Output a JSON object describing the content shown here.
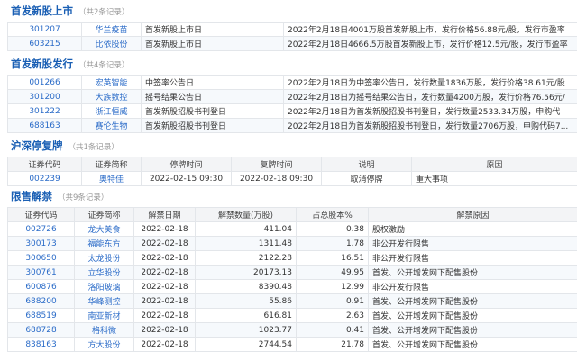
{
  "ipo_listing": {
    "title": "首发新股上市",
    "count": "（共2条记录）",
    "rows": [
      {
        "code": "301207",
        "name": "华兰疫苗",
        "event": "首发新股上市日",
        "desc": "2022年2月18日4001万股首发新股上市，发行价格56.88元/股，发行市盈率"
      },
      {
        "code": "603215",
        "name": "比依股份",
        "event": "首发新股上市日",
        "desc": "2022年2月18日4666.5万股首发新股上市，发行价格12.5元/股，发行市盈率"
      }
    ]
  },
  "ipo_issue": {
    "title": "首发新股发行",
    "count": "（共4条记录）",
    "rows": [
      {
        "code": "001266",
        "name": "宏英智能",
        "event": "中签率公告日",
        "desc": "2022年2月18日为中签率公告日，发行数量1836万股，发行价格38.61元/股"
      },
      {
        "code": "301200",
        "name": "大族数控",
        "event": "摇号结果公告日",
        "desc": "2022年2月18日为摇号结果公告日，发行数量4200万股，发行价格76.56元/"
      },
      {
        "code": "301222",
        "name": "浙江恒威",
        "event": "首发新股招股书刊登日",
        "desc": "2022年2月18日为首发新股招股书刊登日，发行数量2533.34万股，申购代"
      },
      {
        "code": "688163",
        "name": "赛伦生物",
        "event": "首发新股招股书刊登日",
        "desc": "2022年2月18日为首发新股招股书刊登日，发行数量2706万股，申购代码7..."
      }
    ]
  },
  "suspension": {
    "title": "沪深停复牌",
    "count": "（共1条记录）",
    "headers": [
      "证券代码",
      "证券简称",
      "停牌时间",
      "复牌时间",
      "说明",
      "原因"
    ],
    "rows": [
      {
        "code": "002239",
        "name": "奥特佳",
        "stop": "2022-02-15 09:30",
        "resume": "2022-02-18 09:30",
        "note": "取消停牌",
        "reason": "重大事项"
      }
    ]
  },
  "unlock": {
    "title": "限售解禁",
    "count": "（共9条记录）",
    "headers": [
      "证券代码",
      "证券简称",
      "解禁日期",
      "解禁数量(万股)",
      "占总股本%",
      "解禁原因"
    ],
    "rows": [
      {
        "code": "002726",
        "name": "龙大美食",
        "date": "2022-02-18",
        "qty": "411.04",
        "pct": "0.38",
        "reason": "股权激励"
      },
      {
        "code": "300173",
        "name": "福能东方",
        "date": "2022-02-18",
        "qty": "1311.48",
        "pct": "1.78",
        "reason": "非公开发行限售"
      },
      {
        "code": "300650",
        "name": "太龙股份",
        "date": "2022-02-18",
        "qty": "2122.28",
        "pct": "16.51",
        "reason": "非公开发行限售"
      },
      {
        "code": "300761",
        "name": "立华股份",
        "date": "2022-02-18",
        "qty": "20173.13",
        "pct": "49.95",
        "reason": "首发、公开增发网下配售股份"
      },
      {
        "code": "600876",
        "name": "洛阳玻璃",
        "date": "2022-02-18",
        "qty": "8390.48",
        "pct": "12.99",
        "reason": "非公开发行限售"
      },
      {
        "code": "688200",
        "name": "华峰测控",
        "date": "2022-02-18",
        "qty": "55.86",
        "pct": "0.91",
        "reason": "首发、公开增发网下配售股份"
      },
      {
        "code": "688519",
        "name": "南亚新材",
        "date": "2022-02-18",
        "qty": "616.81",
        "pct": "2.63",
        "reason": "首发、公开增发网下配售股份"
      },
      {
        "code": "688728",
        "name": "格科微",
        "date": "2022-02-18",
        "qty": "1023.77",
        "pct": "0.41",
        "reason": "首发、公开增发网下配售股份"
      },
      {
        "code": "838163",
        "name": "方大股份",
        "date": "2022-02-18",
        "qty": "2744.54",
        "pct": "21.78",
        "reason": "首发、公开增发网下配售股份"
      }
    ]
  }
}
